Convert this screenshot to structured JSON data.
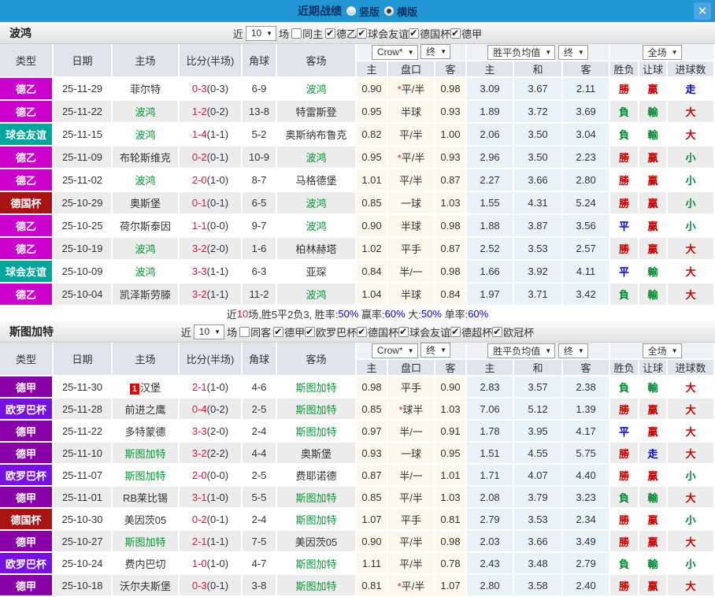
{
  "titlebar": {
    "title": "近期战绩",
    "radio_options": [
      {
        "label": "竖版",
        "selected": false
      },
      {
        "label": "横版",
        "selected": true
      }
    ],
    "close_label": "✕",
    "bar_color": "#2196d3"
  },
  "labels": {
    "near": "近",
    "games": "场"
  },
  "columns": {
    "type": "类型",
    "date": "日期",
    "home": "主场",
    "score": "比分(半场)",
    "corner": "角球",
    "away": "客场",
    "selects": {
      "crow": "Crow*",
      "final": "终",
      "avg": "胜平负均值",
      "final2": "终",
      "fullmatch": "全场"
    },
    "sub": [
      "主",
      "盘口",
      "客",
      "主",
      "和",
      "客",
      "胜负",
      "让球",
      "进球数"
    ]
  },
  "type_colors": {
    "德乙": "#cc00cc",
    "球会友谊": "#00a69c",
    "德国杯": "#a81414",
    "德甲": "#8a00a8",
    "欧罗巴杯": "#7711e0"
  },
  "result_colors": {
    "勝": "#cc0000",
    "贏": "#cc0000",
    "大": "#cc0000",
    "負": "#008833",
    "輸": "#008833",
    "小": "#008833",
    "平": "#0000cc",
    "走": "#0000cc"
  },
  "score_colors": {
    "fulltime": "#ee1133",
    "halftime": "#333344"
  },
  "team_color": "#009933",
  "sections": [
    {
      "team": "波鸿",
      "filters": {
        "count": "10",
        "same": {
          "label": "同主",
          "checked": false
        },
        "leagues": [
          {
            "label": "德乙",
            "checked": true
          },
          {
            "label": "球会友谊",
            "checked": true
          },
          {
            "label": "德国杯",
            "checked": true
          },
          {
            "label": "德甲",
            "checked": true
          }
        ]
      },
      "rows": [
        {
          "type": "德乙",
          "date": "25-11-29",
          "home": "菲尔特",
          "home_focus": false,
          "home_badge": "",
          "score_ft": "0-3",
          "score_ht": "(0-3)",
          "corner": "6-9",
          "away": "波鸿",
          "away_focus": true,
          "odds_home": "0.90",
          "handicap": "平/半",
          "handicap_star": true,
          "odds_away": "0.98",
          "avg_home": "3.09",
          "avg_draw": "3.67",
          "avg_away": "2.11",
          "result_wdl": "勝",
          "result_handicap": "贏",
          "result_goals": "走"
        },
        {
          "type": "德乙",
          "date": "25-11-22",
          "home": "波鸿",
          "home_focus": true,
          "home_badge": "",
          "score_ft": "1-2",
          "score_ht": "(0-2)",
          "corner": "13-8",
          "away": "特雷斯登",
          "away_focus": false,
          "odds_home": "0.95",
          "handicap": "半球",
          "handicap_star": false,
          "odds_away": "0.93",
          "avg_home": "1.89",
          "avg_draw": "3.72",
          "avg_away": "3.69",
          "result_wdl": "負",
          "result_handicap": "輸",
          "result_goals": "大"
        },
        {
          "type": "球会友谊",
          "date": "25-11-15",
          "home": "波鸿",
          "home_focus": true,
          "home_badge": "",
          "score_ft": "1-4",
          "score_ht": "(1-1)",
          "corner": "5-2",
          "away": "奥斯纳布鲁克",
          "away_focus": false,
          "odds_home": "0.82",
          "handicap": "平/半",
          "handicap_star": false,
          "odds_away": "1.00",
          "avg_home": "2.06",
          "avg_draw": "3.50",
          "avg_away": "3.04",
          "result_wdl": "負",
          "result_handicap": "輸",
          "result_goals": "大"
        },
        {
          "type": "德乙",
          "date": "25-11-09",
          "home": "布轮斯维克",
          "home_focus": false,
          "home_badge": "",
          "score_ft": "0-2",
          "score_ht": "(0-1)",
          "corner": "10-9",
          "away": "波鸿",
          "away_focus": true,
          "odds_home": "0.95",
          "handicap": "平/半",
          "handicap_star": true,
          "odds_away": "0.93",
          "avg_home": "2.96",
          "avg_draw": "3.50",
          "avg_away": "2.23",
          "result_wdl": "勝",
          "result_handicap": "贏",
          "result_goals": "小"
        },
        {
          "type": "德乙",
          "date": "25-11-02",
          "home": "波鸿",
          "home_focus": true,
          "home_badge": "",
          "score_ft": "2-0",
          "score_ht": "(1-0)",
          "corner": "8-7",
          "away": "马格德堡",
          "away_focus": false,
          "odds_home": "1.01",
          "handicap": "平/半",
          "handicap_star": false,
          "odds_away": "0.87",
          "avg_home": "2.27",
          "avg_draw": "3.66",
          "avg_away": "2.80",
          "result_wdl": "勝",
          "result_handicap": "贏",
          "result_goals": "小"
        },
        {
          "type": "德国杯",
          "date": "25-10-29",
          "home": "奥斯堡",
          "home_focus": false,
          "home_badge": "",
          "score_ft": "0-1",
          "score_ht": "(0-1)",
          "corner": "6-5",
          "away": "波鸿",
          "away_focus": true,
          "odds_home": "0.85",
          "handicap": "一球",
          "handicap_star": false,
          "odds_away": "1.03",
          "avg_home": "1.55",
          "avg_draw": "4.31",
          "avg_away": "5.24",
          "result_wdl": "勝",
          "result_handicap": "贏",
          "result_goals": "小"
        },
        {
          "type": "德乙",
          "date": "25-10-25",
          "home": "荷尔斯泰因",
          "home_focus": false,
          "home_badge": "",
          "score_ft": "1-1",
          "score_ht": "(0-0)",
          "corner": "9-7",
          "away": "波鸿",
          "away_focus": true,
          "odds_home": "0.90",
          "handicap": "半球",
          "handicap_star": false,
          "odds_away": "0.98",
          "avg_home": "1.88",
          "avg_draw": "3.87",
          "avg_away": "3.56",
          "result_wdl": "平",
          "result_handicap": "贏",
          "result_goals": "小"
        },
        {
          "type": "德乙",
          "date": "25-10-19",
          "home": "波鸿",
          "home_focus": true,
          "home_badge": "",
          "score_ft": "3-2",
          "score_ht": "(2-0)",
          "corner": "1-6",
          "away": "柏林赫塔",
          "away_focus": false,
          "odds_home": "1.02",
          "handicap": "平手",
          "handicap_star": false,
          "odds_away": "0.87",
          "avg_home": "2.52",
          "avg_draw": "3.53",
          "avg_away": "2.57",
          "result_wdl": "勝",
          "result_handicap": "贏",
          "result_goals": "大"
        },
        {
          "type": "球会友谊",
          "date": "25-10-09",
          "home": "波鸿",
          "home_focus": true,
          "home_badge": "",
          "score_ft": "3-3",
          "score_ht": "(1-1)",
          "corner": "6-3",
          "away": "亚琛",
          "away_focus": false,
          "odds_home": "0.84",
          "handicap": "半/一",
          "handicap_star": false,
          "odds_away": "0.98",
          "avg_home": "1.66",
          "avg_draw": "3.92",
          "avg_away": "4.11",
          "result_wdl": "平",
          "result_handicap": "輸",
          "result_goals": "大"
        },
        {
          "type": "德乙",
          "date": "25-10-04",
          "home": "凯泽斯劳滕",
          "home_focus": false,
          "home_badge": "",
          "score_ft": "3-2",
          "score_ht": "(1-1)",
          "corner": "11-2",
          "away": "波鸿",
          "away_focus": true,
          "odds_home": "1.04",
          "handicap": "半球",
          "handicap_star": false,
          "odds_away": "0.84",
          "avg_home": "1.97",
          "avg_draw": "3.71",
          "avg_away": "3.42",
          "result_wdl": "負",
          "result_handicap": "輸",
          "result_goals": "大"
        }
      ],
      "summary": [
        {
          "text": "近",
          "color": "#333333"
        },
        {
          "text": "10",
          "color": "#ee1133"
        },
        {
          "text": "场,胜5平2负3, 胜率:",
          "color": "#333333"
        },
        {
          "text": "50%",
          "color": "#0000ee"
        },
        {
          "text": " 赢率:",
          "color": "#333333"
        },
        {
          "text": "60%",
          "color": "#0000ee"
        },
        {
          "text": " 大:",
          "color": "#333333"
        },
        {
          "text": "50%",
          "color": "#0000ee"
        },
        {
          "text": " 单率:",
          "color": "#333333"
        },
        {
          "text": "60%",
          "color": "#0000ee"
        }
      ]
    },
    {
      "team": "斯图加特",
      "filters": {
        "count": "10",
        "same": {
          "label": "同客",
          "checked": false
        },
        "leagues": [
          {
            "label": "德甲",
            "checked": true
          },
          {
            "label": "欧罗巴杯",
            "checked": true
          },
          {
            "label": "德国杯",
            "checked": true
          },
          {
            "label": "球会友谊",
            "checked": true
          },
          {
            "label": "德超杯",
            "checked": true
          },
          {
            "label": "欧冠杯",
            "checked": true
          }
        ]
      },
      "rows": [
        {
          "type": "德甲",
          "date": "25-11-30",
          "home": "汉堡",
          "home_focus": false,
          "home_badge": "1",
          "score_ft": "2-1",
          "score_ht": "(1-0)",
          "corner": "4-6",
          "away": "斯图加特",
          "away_focus": true,
          "odds_home": "0.98",
          "handicap": "平手",
          "handicap_star": false,
          "odds_away": "0.90",
          "avg_home": "2.83",
          "avg_draw": "3.57",
          "avg_away": "2.38",
          "result_wdl": "負",
          "result_handicap": "輸",
          "result_goals": "大"
        },
        {
          "type": "欧罗巴杯",
          "date": "25-11-28",
          "home": "前进之鹰",
          "home_focus": false,
          "home_badge": "",
          "score_ft": "0-4",
          "score_ht": "(0-2)",
          "corner": "2-5",
          "away": "斯图加特",
          "away_focus": true,
          "odds_home": "0.85",
          "handicap": "球半",
          "handicap_star": true,
          "odds_away": "1.03",
          "avg_home": "7.06",
          "avg_draw": "5.12",
          "avg_away": "1.39",
          "result_wdl": "勝",
          "result_handicap": "贏",
          "result_goals": "大"
        },
        {
          "type": "德甲",
          "date": "25-11-22",
          "home": "多特蒙德",
          "home_focus": false,
          "home_badge": "",
          "score_ft": "3-3",
          "score_ht": "(2-0)",
          "corner": "2-4",
          "away": "斯图加特",
          "away_focus": true,
          "odds_home": "0.97",
          "handicap": "半/一",
          "handicap_star": false,
          "odds_away": "0.91",
          "avg_home": "1.78",
          "avg_draw": "3.95",
          "avg_away": "4.17",
          "result_wdl": "平",
          "result_handicap": "贏",
          "result_goals": "大"
        },
        {
          "type": "德甲",
          "date": "25-11-10",
          "home": "斯图加特",
          "home_focus": true,
          "home_badge": "",
          "score_ft": "3-2",
          "score_ht": "(2-2)",
          "corner": "4-4",
          "away": "奥斯堡",
          "away_focus": false,
          "odds_home": "0.93",
          "handicap": "一球",
          "handicap_star": false,
          "odds_away": "0.95",
          "avg_home": "1.51",
          "avg_draw": "4.55",
          "avg_away": "5.75",
          "result_wdl": "勝",
          "result_handicap": "走",
          "result_goals": "大"
        },
        {
          "type": "欧罗巴杯",
          "date": "25-11-07",
          "home": "斯图加特",
          "home_focus": true,
          "home_badge": "",
          "score_ft": "2-0",
          "score_ht": "(0-0)",
          "corner": "2-5",
          "away": "费耶诺德",
          "away_focus": false,
          "odds_home": "0.87",
          "handicap": "半/一",
          "handicap_star": false,
          "odds_away": "1.01",
          "avg_home": "1.71",
          "avg_draw": "4.07",
          "avg_away": "4.40",
          "result_wdl": "勝",
          "result_handicap": "贏",
          "result_goals": "小"
        },
        {
          "type": "德甲",
          "date": "25-11-01",
          "home": "RB莱比锡",
          "home_focus": false,
          "home_badge": "",
          "score_ft": "3-1",
          "score_ht": "(1-0)",
          "corner": "5-5",
          "away": "斯图加特",
          "away_focus": true,
          "odds_home": "0.85",
          "handicap": "平/半",
          "handicap_star": false,
          "odds_away": "1.03",
          "avg_home": "2.08",
          "avg_draw": "3.79",
          "avg_away": "3.23",
          "result_wdl": "負",
          "result_handicap": "輸",
          "result_goals": "大"
        },
        {
          "type": "德国杯",
          "date": "25-10-30",
          "home": "美因茨05",
          "home_focus": false,
          "home_badge": "",
          "score_ft": "0-2",
          "score_ht": "(0-1)",
          "corner": "2-4",
          "away": "斯图加特",
          "away_focus": true,
          "odds_home": "1.07",
          "handicap": "平手",
          "handicap_star": false,
          "odds_away": "0.81",
          "avg_home": "2.79",
          "avg_draw": "3.53",
          "avg_away": "2.34",
          "result_wdl": "勝",
          "result_handicap": "贏",
          "result_goals": "小"
        },
        {
          "type": "德甲",
          "date": "25-10-27",
          "home": "斯图加特",
          "home_focus": true,
          "home_badge": "",
          "score_ft": "2-1",
          "score_ht": "(1-1)",
          "corner": "7-5",
          "away": "美因茨05",
          "away_focus": false,
          "odds_home": "0.90",
          "handicap": "平/半",
          "handicap_star": false,
          "odds_away": "0.98",
          "avg_home": "2.03",
          "avg_draw": "3.66",
          "avg_away": "3.49",
          "result_wdl": "勝",
          "result_handicap": "贏",
          "result_goals": "大"
        },
        {
          "type": "欧罗巴杯",
          "date": "25-10-24",
          "home": "费内巴切",
          "home_focus": false,
          "home_badge": "",
          "score_ft": "1-0",
          "score_ht": "(1-0)",
          "corner": "4-7",
          "away": "斯图加特",
          "away_focus": true,
          "odds_home": "1.11",
          "handicap": "平/半",
          "handicap_star": false,
          "odds_away": "0.78",
          "avg_home": "2.43",
          "avg_draw": "3.48",
          "avg_away": "2.79",
          "result_wdl": "負",
          "result_handicap": "輸",
          "result_goals": "小"
        },
        {
          "type": "德甲",
          "date": "25-10-18",
          "home": "沃尔夫斯堡",
          "home_focus": false,
          "home_badge": "",
          "score_ft": "0-3",
          "score_ht": "(0-1)",
          "corner": "3-8",
          "away": "斯图加特",
          "away_focus": true,
          "odds_home": "0.81",
          "handicap": "平/半",
          "handicap_star": true,
          "odds_away": "1.07",
          "avg_home": "2.80",
          "avg_draw": "3.58",
          "avg_away": "2.40",
          "result_wdl": "勝",
          "result_handicap": "贏",
          "result_goals": "大"
        }
      ],
      "summary": []
    }
  ]
}
